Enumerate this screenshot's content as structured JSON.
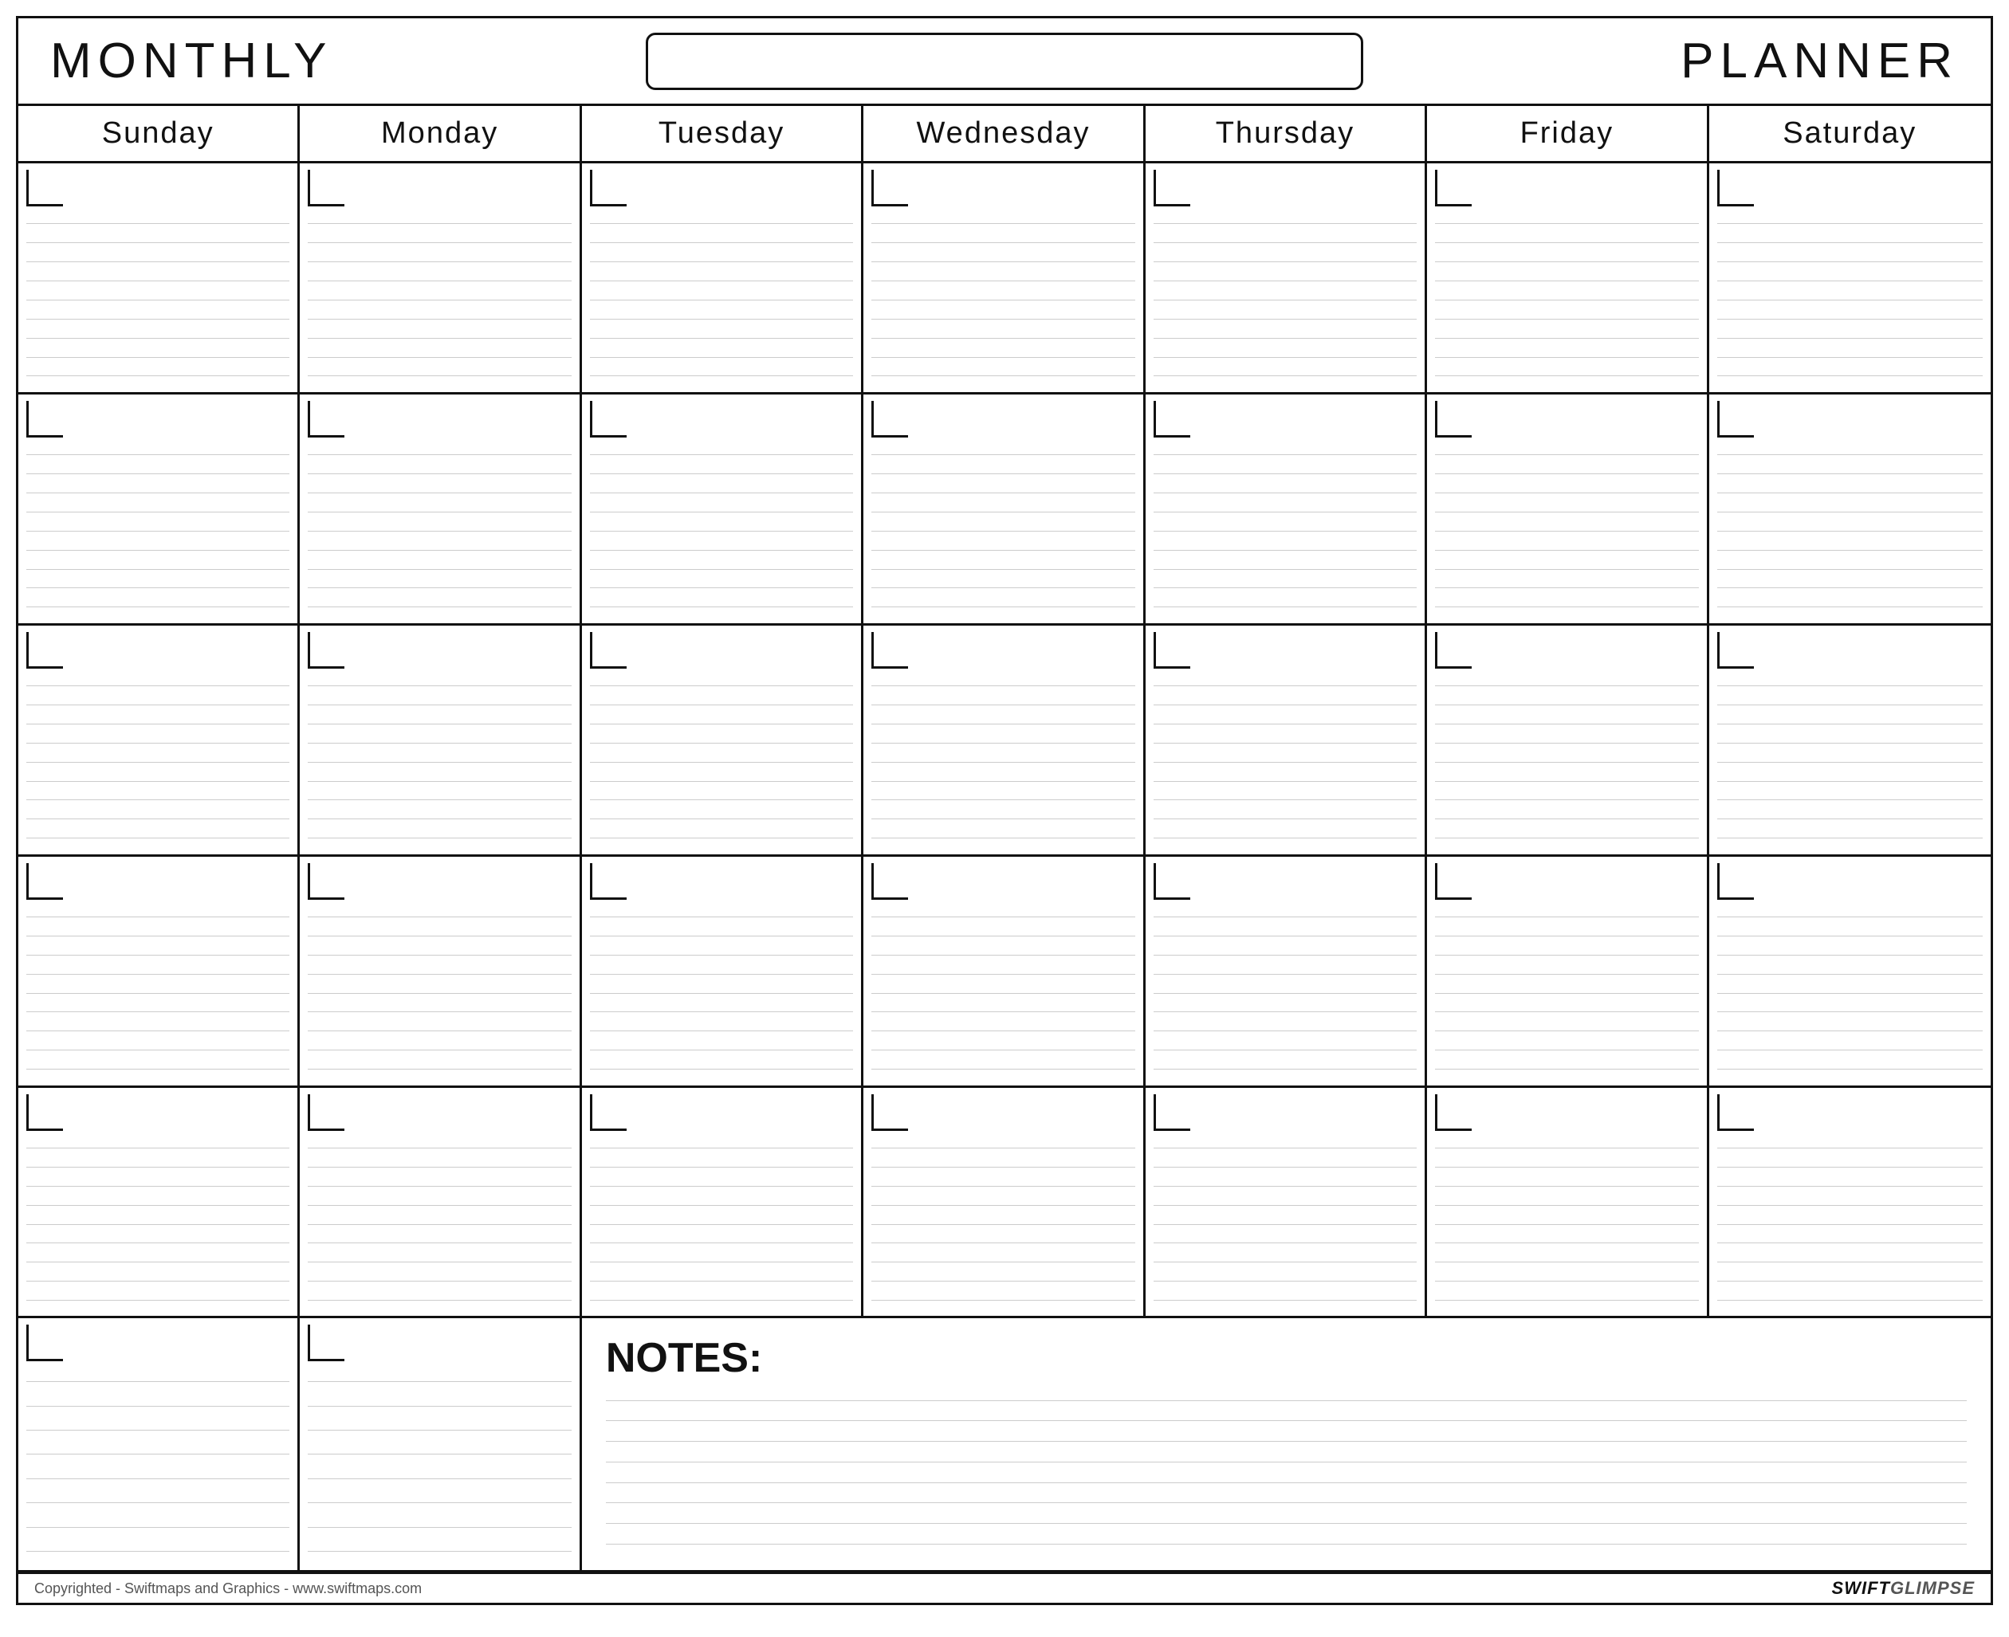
{
  "header": {
    "monthly_label": "MONTHLY",
    "planner_label": "PLANNER",
    "title_input_placeholder": ""
  },
  "days": {
    "headers": [
      "Sunday",
      "Monday",
      "Tuesday",
      "Wednesday",
      "Thursday",
      "Friday",
      "Saturday"
    ]
  },
  "rows": 5,
  "notes_label": "NOTES:",
  "footer": {
    "copyright": "Copyrighted - Swiftmaps and Graphics - www.swiftmaps.com",
    "brand": "SWIFT GLIMPSE"
  },
  "cell_lines_count": 9,
  "notes_lines_count": 8
}
